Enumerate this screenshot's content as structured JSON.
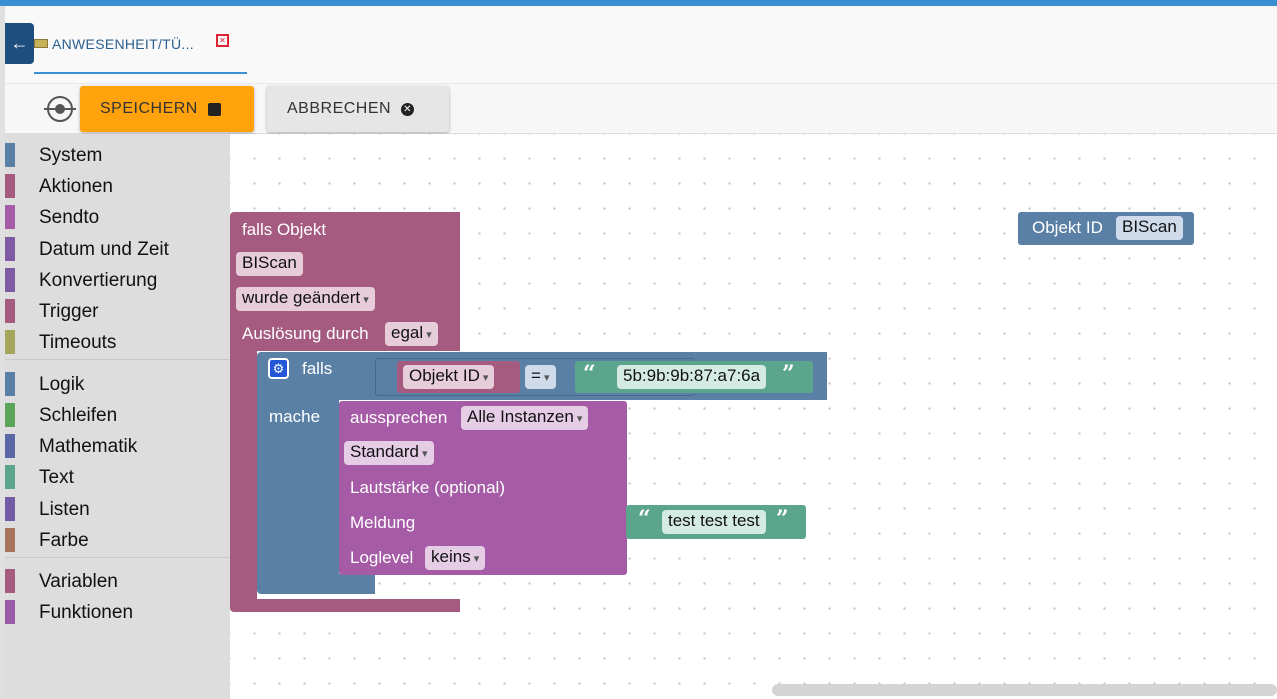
{
  "tab": {
    "title": "ANWESENHEIT/TÜ..."
  },
  "toolbar": {
    "save_label": "SPEICHERN",
    "cancel_label": "ABBRECHEN"
  },
  "categories": [
    {
      "label": "System",
      "color": "#5b80a5"
    },
    {
      "label": "Aktionen",
      "color": "#a55b80"
    },
    {
      "label": "Sendto",
      "color": "#a55ba5"
    },
    {
      "label": "Datum und Zeit",
      "color": "#805ba5"
    },
    {
      "label": "Konvertierung",
      "color": "#805ba5"
    },
    {
      "label": "Trigger",
      "color": "#a55b80"
    },
    {
      "label": "Timeouts",
      "color": "#a5a55b"
    },
    {
      "label": "Logik",
      "color": "#5b80a5"
    },
    {
      "label": "Schleifen",
      "color": "#5ba55b"
    },
    {
      "label": "Mathematik",
      "color": "#5b67a5"
    },
    {
      "label": "Text",
      "color": "#5ba58c"
    },
    {
      "label": "Listen",
      "color": "#745ba5"
    },
    {
      "label": "Farbe",
      "color": "#a5745b"
    },
    {
      "label": "Variablen",
      "color": "#a55b80"
    },
    {
      "label": "Funktionen",
      "color": "#995ba5"
    }
  ],
  "trigger_block": {
    "title": "falls Objekt",
    "object": "BIScan",
    "change": "wurde geändert",
    "ack_label": "Auslösung durch",
    "ack_value": "egal"
  },
  "if_block": {
    "if_label": "falls",
    "do_label": "mache",
    "left": "Objekt ID",
    "operator": "=",
    "right": "5b:9b:9b:87:a7:6a"
  },
  "say_block": {
    "label": "aussprechen",
    "instance": "Alle Instanzen",
    "language": "Standard",
    "volume_label": "Lautstärke (optional)",
    "message_label": "Meldung",
    "message": "test test test",
    "loglevel_label": "Loglevel",
    "loglevel": "keins"
  },
  "standalone_block": {
    "label": "Objekt ID",
    "value": "BIScan"
  },
  "colors": {
    "trigger": "#a55b80",
    "logic": "#5b80a5",
    "sendto": "#a55ba5",
    "text": "#5ba58c",
    "accent": "#ffa20c"
  }
}
